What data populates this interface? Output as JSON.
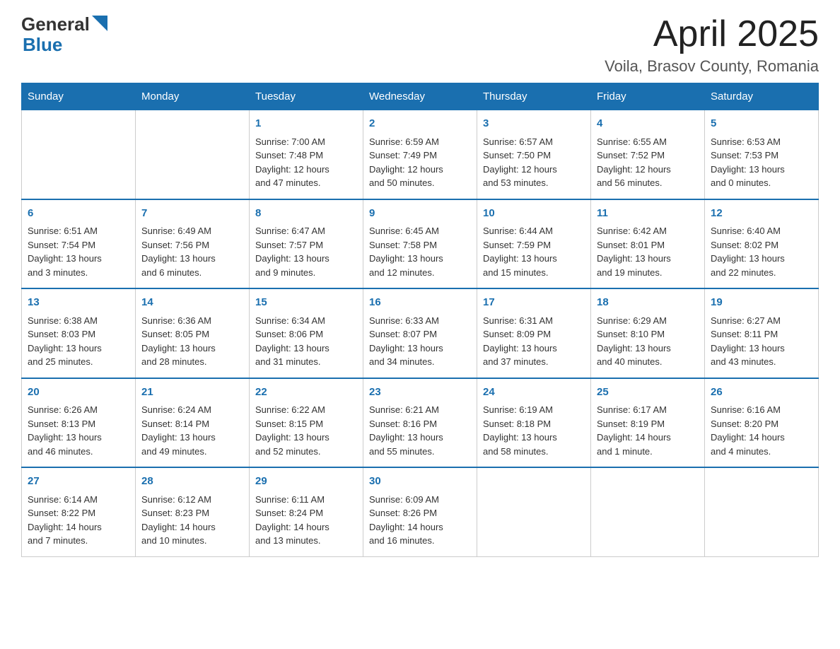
{
  "header": {
    "logo_general": "General",
    "logo_blue": "Blue",
    "month_title": "April 2025",
    "location": "Voila, Brasov County, Romania"
  },
  "weekdays": [
    "Sunday",
    "Monday",
    "Tuesday",
    "Wednesday",
    "Thursday",
    "Friday",
    "Saturday"
  ],
  "weeks": [
    [
      {
        "day": "",
        "info": ""
      },
      {
        "day": "",
        "info": ""
      },
      {
        "day": "1",
        "info": "Sunrise: 7:00 AM\nSunset: 7:48 PM\nDaylight: 12 hours\nand 47 minutes."
      },
      {
        "day": "2",
        "info": "Sunrise: 6:59 AM\nSunset: 7:49 PM\nDaylight: 12 hours\nand 50 minutes."
      },
      {
        "day": "3",
        "info": "Sunrise: 6:57 AM\nSunset: 7:50 PM\nDaylight: 12 hours\nand 53 minutes."
      },
      {
        "day": "4",
        "info": "Sunrise: 6:55 AM\nSunset: 7:52 PM\nDaylight: 12 hours\nand 56 minutes."
      },
      {
        "day": "5",
        "info": "Sunrise: 6:53 AM\nSunset: 7:53 PM\nDaylight: 13 hours\nand 0 minutes."
      }
    ],
    [
      {
        "day": "6",
        "info": "Sunrise: 6:51 AM\nSunset: 7:54 PM\nDaylight: 13 hours\nand 3 minutes."
      },
      {
        "day": "7",
        "info": "Sunrise: 6:49 AM\nSunset: 7:56 PM\nDaylight: 13 hours\nand 6 minutes."
      },
      {
        "day": "8",
        "info": "Sunrise: 6:47 AM\nSunset: 7:57 PM\nDaylight: 13 hours\nand 9 minutes."
      },
      {
        "day": "9",
        "info": "Sunrise: 6:45 AM\nSunset: 7:58 PM\nDaylight: 13 hours\nand 12 minutes."
      },
      {
        "day": "10",
        "info": "Sunrise: 6:44 AM\nSunset: 7:59 PM\nDaylight: 13 hours\nand 15 minutes."
      },
      {
        "day": "11",
        "info": "Sunrise: 6:42 AM\nSunset: 8:01 PM\nDaylight: 13 hours\nand 19 minutes."
      },
      {
        "day": "12",
        "info": "Sunrise: 6:40 AM\nSunset: 8:02 PM\nDaylight: 13 hours\nand 22 minutes."
      }
    ],
    [
      {
        "day": "13",
        "info": "Sunrise: 6:38 AM\nSunset: 8:03 PM\nDaylight: 13 hours\nand 25 minutes."
      },
      {
        "day": "14",
        "info": "Sunrise: 6:36 AM\nSunset: 8:05 PM\nDaylight: 13 hours\nand 28 minutes."
      },
      {
        "day": "15",
        "info": "Sunrise: 6:34 AM\nSunset: 8:06 PM\nDaylight: 13 hours\nand 31 minutes."
      },
      {
        "day": "16",
        "info": "Sunrise: 6:33 AM\nSunset: 8:07 PM\nDaylight: 13 hours\nand 34 minutes."
      },
      {
        "day": "17",
        "info": "Sunrise: 6:31 AM\nSunset: 8:09 PM\nDaylight: 13 hours\nand 37 minutes."
      },
      {
        "day": "18",
        "info": "Sunrise: 6:29 AM\nSunset: 8:10 PM\nDaylight: 13 hours\nand 40 minutes."
      },
      {
        "day": "19",
        "info": "Sunrise: 6:27 AM\nSunset: 8:11 PM\nDaylight: 13 hours\nand 43 minutes."
      }
    ],
    [
      {
        "day": "20",
        "info": "Sunrise: 6:26 AM\nSunset: 8:13 PM\nDaylight: 13 hours\nand 46 minutes."
      },
      {
        "day": "21",
        "info": "Sunrise: 6:24 AM\nSunset: 8:14 PM\nDaylight: 13 hours\nand 49 minutes."
      },
      {
        "day": "22",
        "info": "Sunrise: 6:22 AM\nSunset: 8:15 PM\nDaylight: 13 hours\nand 52 minutes."
      },
      {
        "day": "23",
        "info": "Sunrise: 6:21 AM\nSunset: 8:16 PM\nDaylight: 13 hours\nand 55 minutes."
      },
      {
        "day": "24",
        "info": "Sunrise: 6:19 AM\nSunset: 8:18 PM\nDaylight: 13 hours\nand 58 minutes."
      },
      {
        "day": "25",
        "info": "Sunrise: 6:17 AM\nSunset: 8:19 PM\nDaylight: 14 hours\nand 1 minute."
      },
      {
        "day": "26",
        "info": "Sunrise: 6:16 AM\nSunset: 8:20 PM\nDaylight: 14 hours\nand 4 minutes."
      }
    ],
    [
      {
        "day": "27",
        "info": "Sunrise: 6:14 AM\nSunset: 8:22 PM\nDaylight: 14 hours\nand 7 minutes."
      },
      {
        "day": "28",
        "info": "Sunrise: 6:12 AM\nSunset: 8:23 PM\nDaylight: 14 hours\nand 10 minutes."
      },
      {
        "day": "29",
        "info": "Sunrise: 6:11 AM\nSunset: 8:24 PM\nDaylight: 14 hours\nand 13 minutes."
      },
      {
        "day": "30",
        "info": "Sunrise: 6:09 AM\nSunset: 8:26 PM\nDaylight: 14 hours\nand 16 minutes."
      },
      {
        "day": "",
        "info": ""
      },
      {
        "day": "",
        "info": ""
      },
      {
        "day": "",
        "info": ""
      }
    ]
  ]
}
